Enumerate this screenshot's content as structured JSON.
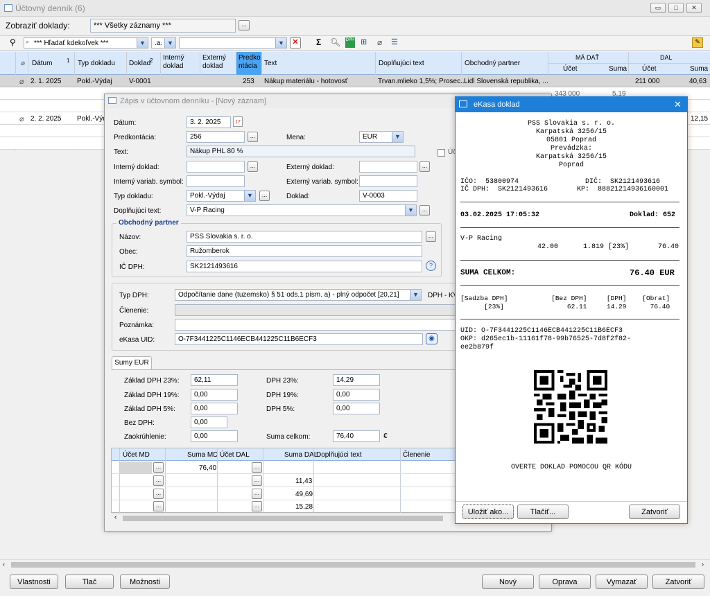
{
  "main_window": {
    "title": "Účtovný denník (6)",
    "filter_label": "Zobraziť doklady:",
    "filter_value": "*** Všetky záznamy ***",
    "search_placeholder": "*** Hľadať kdekoľvek ***",
    "search_mode": ".a."
  },
  "grid": {
    "headers": {
      "date": "Dátum",
      "sort1": "1",
      "doc_type": "Typ dokladu",
      "doc": "Doklad",
      "sort2": "2",
      "internal_doc": "Interný doklad",
      "external_doc": "Externý doklad",
      "predkontacia": "Predko ntácia",
      "text": "Text",
      "extra_text": "Doplňujúci text",
      "partner": "Obchodný partner",
      "ma_dat": "MÁ DAŤ",
      "dal": "DAL",
      "ucet": "Účet",
      "suma": "Suma"
    },
    "rows": [
      {
        "date": "2. 1. 2025",
        "type": "Pokl.-Výdaj",
        "doc": "V-0001",
        "pred": "253",
        "text": "Nákup materiálu - hotovosť",
        "extra": "Trvan.mlieko 1,5%; Prosec...",
        "partner": "Lidl Slovenská republika, ...",
        "dal_ucet": "211 000",
        "dal_suma": "40,63"
      },
      {
        "date": "2. 2. 2025",
        "type": "Pokl.-Výdaj",
        "dal_suma": "12,15"
      }
    ],
    "partial_values": {
      "a": "343 000",
      "b": "5,19"
    }
  },
  "dialog": {
    "title": "Zápis v účtovnom denníku - [Nový záznam]",
    "datum_label": "Dátum:",
    "datum": "3. 2. 2025",
    "predkontacia_label": "Predkontácia:",
    "predkontacia": "256",
    "mena_label": "Mena:",
    "mena": "EUR",
    "text_label": "Text:",
    "text": "Nákup PHL 80 %",
    "uc_label": "Úč",
    "interny_label": "Interný doklad:",
    "externy_label": "Externý doklad:",
    "int_var_label": "Interný variab. symbol:",
    "ext_var_label": "Externý variab. symbol:",
    "typ_label": "Typ dokladu:",
    "typ": "Pokl.-Výdaj",
    "doklad_label": "Doklad:",
    "doklad": "V-0003",
    "dopl_label": "Doplňujúci text:",
    "dopl": "V-P Racing",
    "partner_group": "Obchodný partner",
    "nazov_label": "Názov:",
    "nazov": "PSS Slovakia s. r. o.",
    "obec_label": "Obec:",
    "obec": "Ružomberok",
    "icdph_label": "IČ DPH:",
    "icdph": "SK2121493616",
    "typdph_label": "Typ DPH:",
    "typdph": "Odpočítanie dane (tuzemsko) § 51 ods.1 písm. a) - plný odpočet [20,21]",
    "dph_kv": "DPH - KV",
    "clenenie_label": "Členenie:",
    "poznamka_label": "Poznámka:",
    "ekasa_label": "eKasa UID:",
    "ekasa": "O-7F3441225C1146ECB441225C11B6ECF3",
    "tab": "Sumy EUR",
    "sums": {
      "zaklad23_label": "Základ DPH 23%:",
      "zaklad23": "62,11",
      "zaklad19_label": "Základ DPH 19%:",
      "zaklad19": "0,00",
      "zaklad5_label": "Základ DPH 5%:",
      "zaklad5": "0,00",
      "bezdph_label": "Bez DPH:",
      "bezdph": "0,00",
      "zaokr_label": "Zaokrúhlenie:",
      "zaokr": "0,00",
      "dph23_label": "DPH 23%:",
      "dph23": "14,29",
      "dph19_label": "DPH 19%:",
      "dph19": "0,00",
      "dph5_label": "DPH 5%:",
      "dph5": "0,00",
      "suma_label": "Suma celkom:",
      "suma": "76,40",
      "euro": "€"
    },
    "lines_headers": {
      "ucet_md": "Účet MD",
      "suma_md": "Suma MD",
      "ucet_dal": "Účet DAL",
      "suma_dal": "Suma DAL",
      "dopl": "Doplňujúci text",
      "clen": "Členenie"
    },
    "lines": [
      {
        "suma_md": "76,40",
        "suma_dal": ""
      },
      {
        "suma_md": "",
        "suma_dal": "11,43"
      },
      {
        "suma_md": "",
        "suma_dal": "49,69"
      },
      {
        "suma_md": "",
        "suma_dal": "15,28"
      }
    ]
  },
  "ekasa": {
    "title": "eKasa doklad",
    "company": "PSS Slovakia s. r. o.",
    "street": "Karpatská 3256/15",
    "city": "05801 Poprad",
    "prevadzka": "Prevádzka:",
    "p_street": "Karpatská 3256/15",
    "p_city": "Poprad",
    "ico_line": "IČO:  53800974                DIČ:  SK2121493616",
    "icdph_line": "IČ DPH:  SK2121493616       KP:  88821214936160001",
    "datetime": "03.02.2025 17:05:32",
    "doklad": "Doklad: 652",
    "item_name": "V-P Racing",
    "item_line": "42.00      1.819 [23%]       76.40",
    "suma_label": "SUMA CELKOM:",
    "suma_value": "76.40 EUR",
    "vat_head": "[Sadzba DPH]           [Bez DPH]     [DPH]    [Obrat]",
    "vat_row": "      [23%]                62.11     14.29      76.40",
    "uid": "UID: O-7F3441225C1146ECB441225C11B6ECF3",
    "okp1": "OKP: d265ec1b-11161f78-99b76525-7d8f2f82-",
    "okp2": "ee2b879f",
    "overte": "OVERTE DOKLAD POMOCOU QR KÓDU",
    "btn_save": "Uložiť ako...",
    "btn_print": "Tlačiť...",
    "btn_close": "Zatvoriť"
  },
  "bottom": {
    "vlastnosti": "Vlastnosti",
    "tlac": "Tlač",
    "moznosti": "Možnosti",
    "novy": "Nový",
    "oprava": "Oprava",
    "vymazat": "Vymazať",
    "zatvorit": "Zatvoriť"
  },
  "colors": {
    "accent": "#1e7fd8",
    "header": "#d9e8fb",
    "selected": "#d6d6d6"
  }
}
